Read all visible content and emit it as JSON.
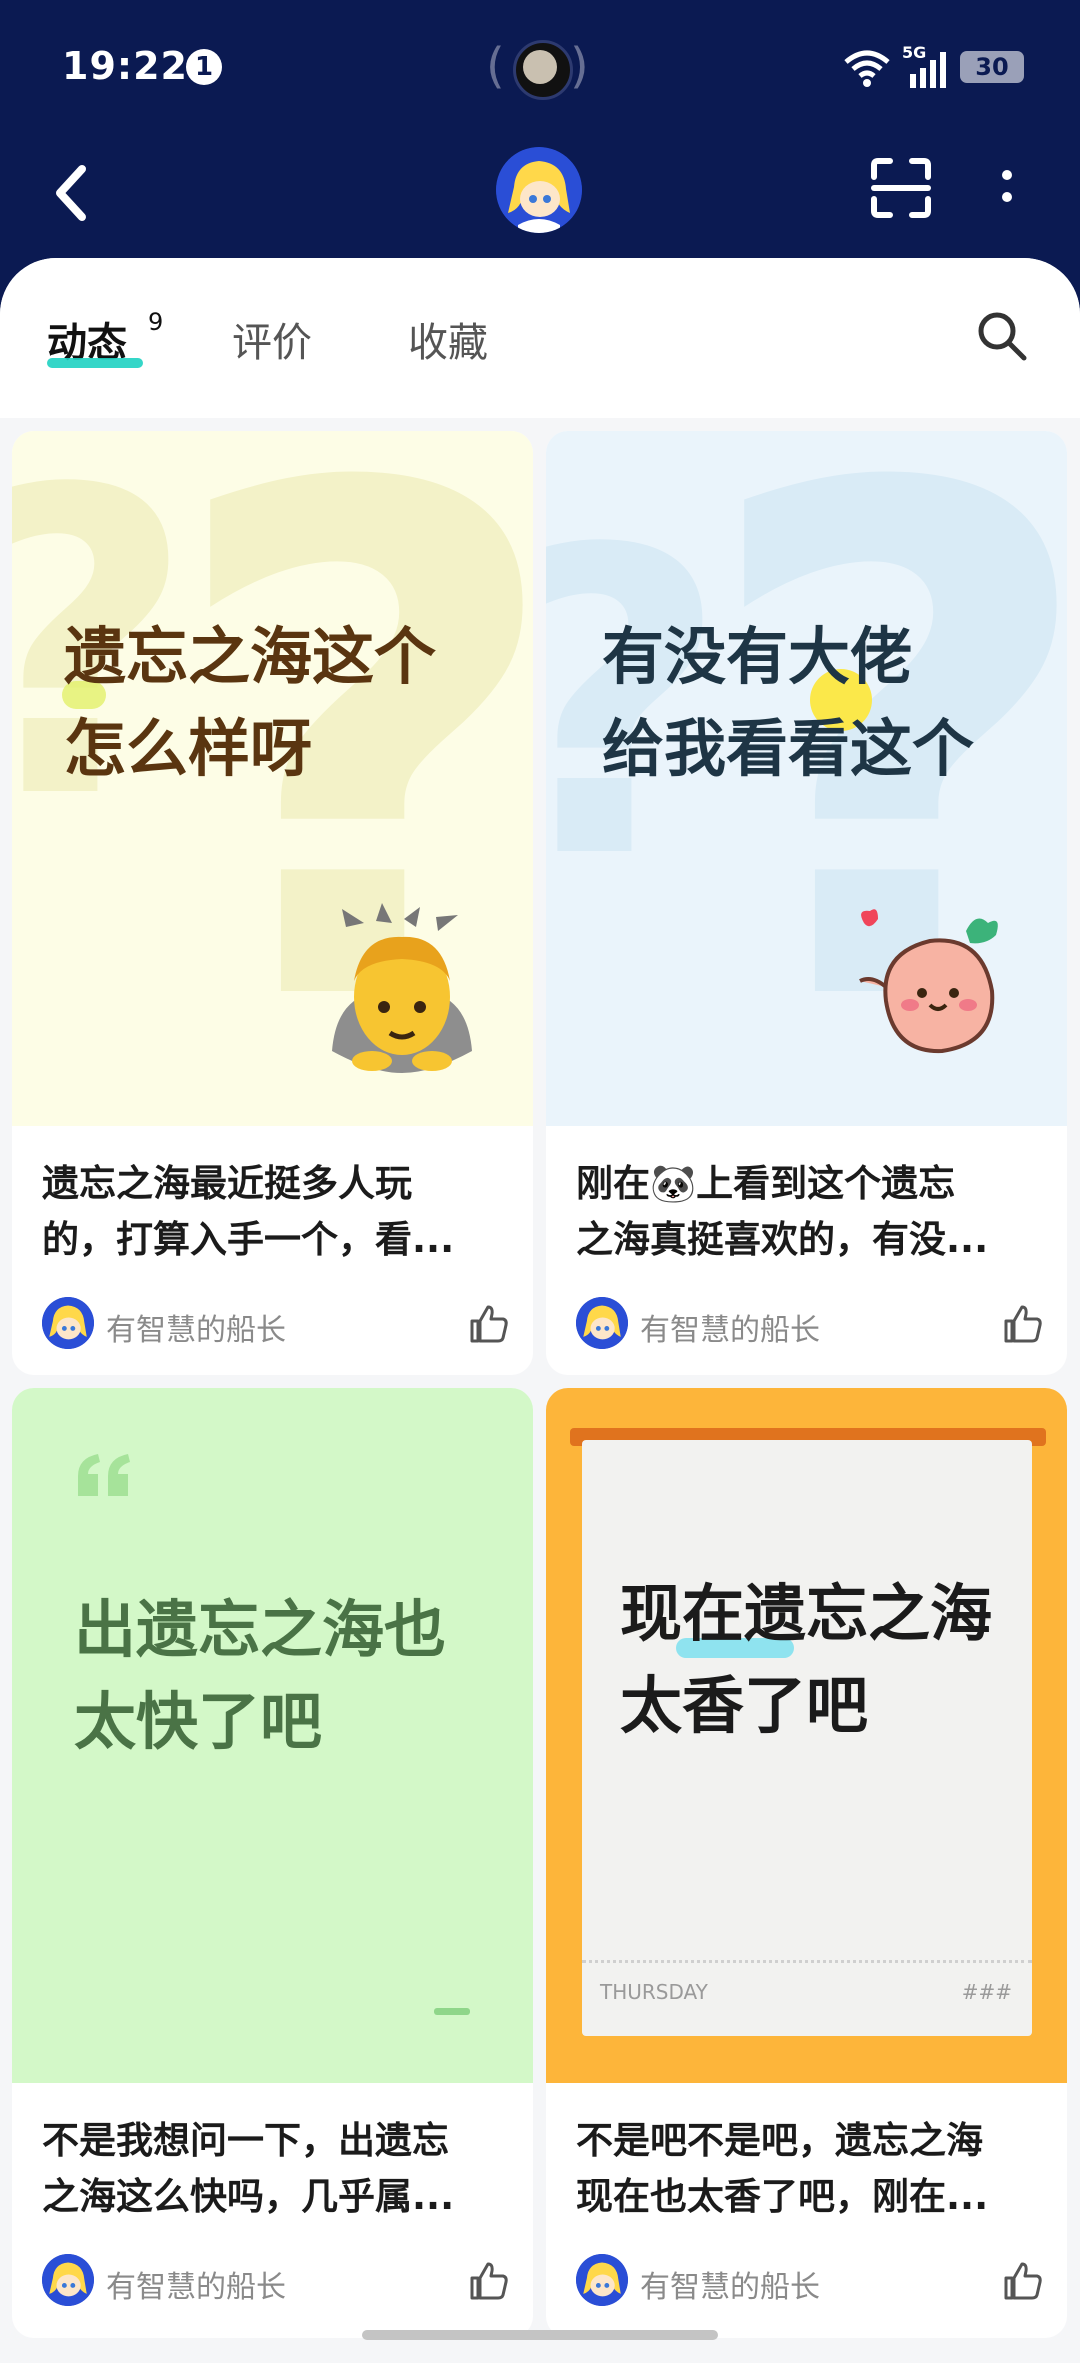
{
  "status": {
    "time": "19:22",
    "info": "1",
    "network": "5G",
    "battery": "30"
  },
  "tabs": [
    {
      "label": "动态",
      "badge": "9"
    },
    {
      "label": "评价"
    },
    {
      "label": "收藏"
    }
  ],
  "cards": [
    {
      "image_lines": [
        "遗忘之海这个",
        "怎么样呀"
      ],
      "title_line1": "遗忘之海最近挺多人玩",
      "title_line2": "的，打算入手一个，看...",
      "author": "有智慧的船长",
      "bg": "#fdfde6"
    },
    {
      "image_lines": [
        "有没有大佬",
        "给我看看这个"
      ],
      "title_line1": "刚在🐼上看到这个遗忘",
      "title_line2": "之海真挺喜欢的，有没...",
      "author": "有智慧的船长",
      "bg": "#eaf4fb"
    },
    {
      "image_lines": [
        "出遗忘之海也",
        "太快了吧"
      ],
      "title_line1": "不是我想问一下，出遗忘",
      "title_line2": "之海这么快吗，几乎属...",
      "author": "有智慧的船长",
      "bg": "#d3f8c8"
    },
    {
      "image_lines": [
        "现在遗忘之海",
        "太香了吧"
      ],
      "ticket_day": "THURSDAY",
      "ticket_code": "###",
      "title_line1": "不是吧不是吧，遗忘之海",
      "title_line2": "现在也太香了吧，刚在...",
      "author": "有智慧的船长",
      "bg": "#fdb53a"
    }
  ],
  "colors": {
    "header": "#0b1a52",
    "accent": "#1fd1c2",
    "card_text_brown": "#5a3510",
    "card_text_navy": "#1e3545",
    "card_text_green": "#4a7346"
  },
  "icons": [
    "back-icon",
    "scan-icon",
    "more-icon",
    "search-icon",
    "like-icon",
    "bow-emoji",
    "peach-sticker",
    "quote-icon"
  ]
}
